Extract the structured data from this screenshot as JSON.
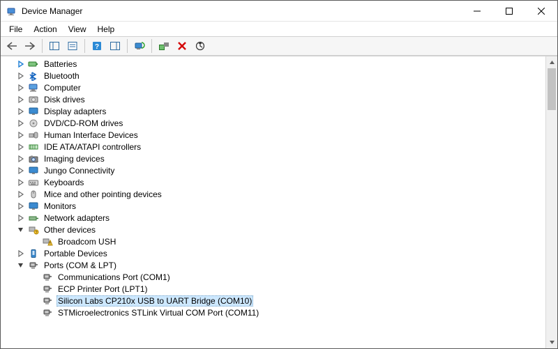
{
  "titlebar": {
    "title": "Device Manager"
  },
  "menu": {
    "file": "File",
    "action": "Action",
    "view": "View",
    "help": "Help"
  },
  "tree": [
    {
      "id": "batteries",
      "label": "Batteries",
      "depth": 1,
      "expander": "closed-active",
      "icon": "battery"
    },
    {
      "id": "bluetooth",
      "label": "Bluetooth",
      "depth": 1,
      "expander": "closed",
      "icon": "bluetooth"
    },
    {
      "id": "computer",
      "label": "Computer",
      "depth": 1,
      "expander": "closed",
      "icon": "computer"
    },
    {
      "id": "disk-drives",
      "label": "Disk drives",
      "depth": 1,
      "expander": "closed",
      "icon": "disk"
    },
    {
      "id": "display-adapters",
      "label": "Display adapters",
      "depth": 1,
      "expander": "closed",
      "icon": "display"
    },
    {
      "id": "dvd-cd",
      "label": "DVD/CD-ROM drives",
      "depth": 1,
      "expander": "closed",
      "icon": "optical"
    },
    {
      "id": "hid",
      "label": "Human Interface Devices",
      "depth": 1,
      "expander": "closed",
      "icon": "hid"
    },
    {
      "id": "ide",
      "label": "IDE ATA/ATAPI controllers",
      "depth": 1,
      "expander": "closed",
      "icon": "ide"
    },
    {
      "id": "imaging",
      "label": "Imaging devices",
      "depth": 1,
      "expander": "closed",
      "icon": "camera"
    },
    {
      "id": "jungo",
      "label": "Jungo Connectivity",
      "depth": 1,
      "expander": "closed",
      "icon": "display"
    },
    {
      "id": "keyboards",
      "label": "Keyboards",
      "depth": 1,
      "expander": "closed",
      "icon": "keyboard"
    },
    {
      "id": "mice",
      "label": "Mice and other pointing devices",
      "depth": 1,
      "expander": "closed",
      "icon": "mouse"
    },
    {
      "id": "monitors",
      "label": "Monitors",
      "depth": 1,
      "expander": "closed",
      "icon": "display"
    },
    {
      "id": "network",
      "label": "Network adapters",
      "depth": 1,
      "expander": "closed",
      "icon": "network"
    },
    {
      "id": "other",
      "label": "Other devices",
      "depth": 1,
      "expander": "open",
      "icon": "other"
    },
    {
      "id": "broadcom-ush",
      "label": "Broadcom USH",
      "depth": 2,
      "expander": "none",
      "icon": "warning"
    },
    {
      "id": "portable",
      "label": "Portable Devices",
      "depth": 1,
      "expander": "closed",
      "icon": "portable"
    },
    {
      "id": "ports",
      "label": "Ports (COM & LPT)",
      "depth": 1,
      "expander": "open",
      "icon": "port"
    },
    {
      "id": "com1",
      "label": "Communications Port (COM1)",
      "depth": 2,
      "expander": "none",
      "icon": "port"
    },
    {
      "id": "lpt1",
      "label": "ECP Printer Port (LPT1)",
      "depth": 2,
      "expander": "none",
      "icon": "port"
    },
    {
      "id": "cp210x",
      "label": "Silicon Labs CP210x USB to UART Bridge (COM10)",
      "depth": 2,
      "expander": "none",
      "icon": "port",
      "selected": true
    },
    {
      "id": "stlink",
      "label": "STMicroelectronics STLink Virtual COM Port (COM11)",
      "depth": 2,
      "expander": "none",
      "icon": "port"
    }
  ]
}
